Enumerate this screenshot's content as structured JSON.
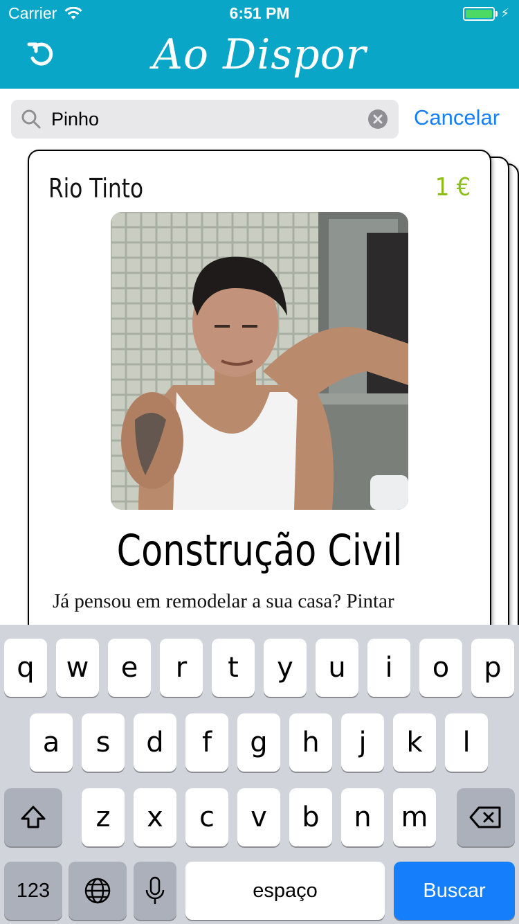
{
  "status_bar": {
    "carrier": "Carrier",
    "time": "6:51 PM"
  },
  "nav": {
    "title": "Ao Dispor",
    "refresh_icon": "refresh-icon"
  },
  "search": {
    "value": "Pinho",
    "cancel_label": "Cancelar"
  },
  "card": {
    "location": "Rio Tinto",
    "price": "1 €",
    "title": "Construção Civil",
    "description": "Já pensou em remodelar a sua casa? Pintar",
    "photo_subject": "man in white tank top leaning on ledge"
  },
  "keyboard": {
    "row1": [
      "q",
      "w",
      "e",
      "r",
      "t",
      "y",
      "u",
      "i",
      "o",
      "p"
    ],
    "row2": [
      "a",
      "s",
      "d",
      "f",
      "g",
      "h",
      "j",
      "k",
      "l"
    ],
    "row3": [
      "z",
      "x",
      "c",
      "v",
      "b",
      "n",
      "m"
    ],
    "numbers_label": "123",
    "space_label": "espaço",
    "return_label": "Buscar"
  },
  "colors": {
    "header": "#0aa6c8",
    "price": "#8cbe1a",
    "accent": "#147efb"
  }
}
